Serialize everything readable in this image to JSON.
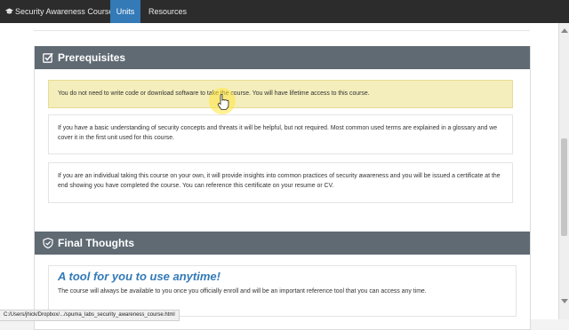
{
  "navbar": {
    "brand_label": "Security Awareness Course",
    "tabs": [
      {
        "label": "Units",
        "active": true
      },
      {
        "label": "Resources",
        "active": false
      }
    ]
  },
  "prerequisites": {
    "title": "Prerequisites",
    "note": "You do not need to write code or download software to take the course. You will have lifetime access to this course.",
    "paragraphs": [
      "If you have a basic understanding of security concepts and threats it will be helpful, but not required. Most common used terms are explained in a glossary and we cover it in the first unit used for this course.",
      "If you are an individual taking this course on your own, it will provide insights into common practices of security awareness and you will be issued a certificate at the end showing you have completed the course. You can reference this certificate on your resume or CV."
    ]
  },
  "final_thoughts": {
    "title": "Final Thoughts",
    "tool_heading": "A tool for you to use anytime!",
    "tool_text": "The course will always be available to you once you officially enroll and will be an important reference tool that you can access any time."
  },
  "status_bar": {
    "url": "C:/Users/jhick/Dropbox/.../spuma_labs_security_awareness_course.html"
  },
  "colors": {
    "navbar_bg": "#2c2c2c",
    "active_tab": "#337ab7",
    "panel_header": "#5f6a73",
    "note_bg": "#f4eebc",
    "heading_accent": "#337ab7"
  },
  "icons": [
    "graduation-cap-icon",
    "checkbox-icon",
    "shield-icon",
    "hand-pointer-icon"
  ]
}
